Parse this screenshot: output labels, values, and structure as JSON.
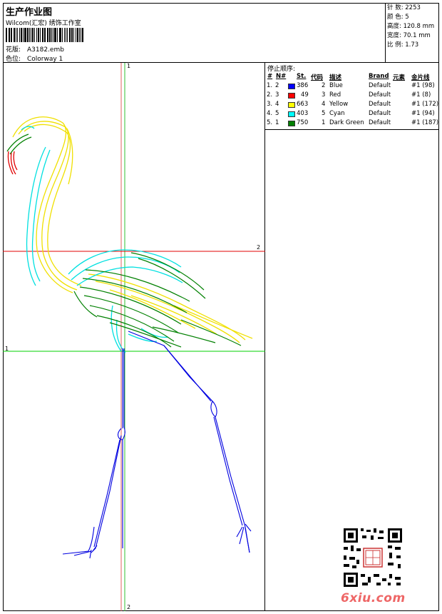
{
  "header": {
    "title": "生产作业图",
    "subtitle": "Wilcom(汇宏) 绣饰工作室",
    "design_label": "花版:",
    "design_value": "A3182.emb",
    "colorway_label": "色位:",
    "colorway_value": "Colorway 1"
  },
  "stats": {
    "stitches": "针 数: 2253",
    "colors": "颜 色: 5",
    "height": "高度: 120.8 mm",
    "width": "宽度: 70.1 mm",
    "scale": "比 例: 1.73"
  },
  "canvas": {
    "v1_label": "1",
    "v2_label": "2",
    "h1_label": "1",
    "h2_label": "2",
    "h2_label_right": "2"
  },
  "stop_sequence": {
    "title": "停止顺序:",
    "headers": {
      "num": "#",
      "n": "N#",
      "st": "St.",
      "code": "代码",
      "desc": "描述",
      "brand": "Brand",
      "element": "元素",
      "thread": "金片线"
    },
    "rows": [
      {
        "num": "1.",
        "n": "2",
        "color": "#0000ff",
        "st": "386",
        "code": "2",
        "desc": "Blue",
        "brand": "Default",
        "thread": "#1 (98)"
      },
      {
        "num": "2.",
        "n": "3",
        "color": "#ff0000",
        "st": "49",
        "code": "3",
        "desc": "Red",
        "brand": "Default",
        "thread": "#1 (8)"
      },
      {
        "num": "3.",
        "n": "4",
        "color": "#ffff00",
        "st": "663",
        "code": "4",
        "desc": "Yellow",
        "brand": "Default",
        "thread": "#1 (172)"
      },
      {
        "num": "4.",
        "n": "5",
        "color": "#00ffff",
        "st": "403",
        "code": "5",
        "desc": "Cyan",
        "brand": "Default",
        "thread": "#1 (94)"
      },
      {
        "num": "5.",
        "n": "1",
        "color": "#008000",
        "st": "750",
        "code": "1",
        "desc": "Dark Green",
        "brand": "Default",
        "thread": "#1 (187)"
      }
    ]
  },
  "watermark": "6xiu.com",
  "icons": [
    "barcode-icon",
    "qr-code-icon",
    "seal-icon"
  ]
}
